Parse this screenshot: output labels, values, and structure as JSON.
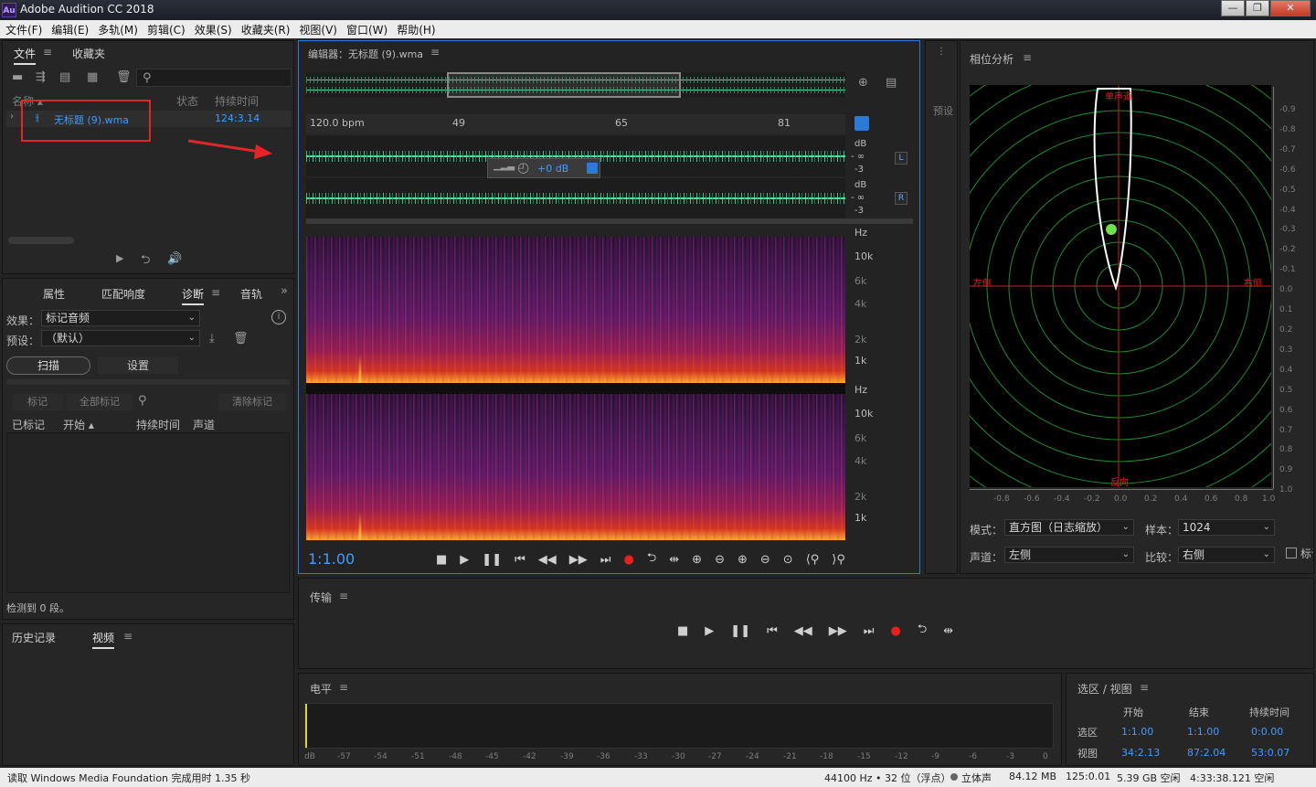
{
  "window": {
    "app_icon": "Au",
    "title": "Adobe Audition CC 2018",
    "min_label": "—",
    "max_label": "❐",
    "close_label": "✕"
  },
  "menu": [
    "文件(F)",
    "编辑(E)",
    "多轨(M)",
    "剪辑(C)",
    "效果(S)",
    "收藏夹(R)",
    "视图(V)",
    "窗口(W)",
    "帮助(H)"
  ],
  "files_panel": {
    "tabs": [
      "文件",
      "收藏夹"
    ],
    "columns": {
      "name": "名称 ▴",
      "status": "状态",
      "duration": "持续时间"
    },
    "file": {
      "name": "无标题 (9).wma",
      "duration": "124:3.14"
    }
  },
  "diag_panel": {
    "tabs": [
      "属性",
      "匹配响度",
      "诊断",
      "音轨"
    ],
    "effect_label": "效果：",
    "effect_value": "标记音频",
    "preset_label": "预设：",
    "preset_value": "（默认）",
    "scan_button": "扫描",
    "settings_button": "设置",
    "mark_button": "标记",
    "mark_all_button": "全部标记",
    "clear_button": "清除标记",
    "columns": [
      "已标记",
      "开始 ▴",
      "持续时间",
      "声道"
    ],
    "status": "检测到 0 段。"
  },
  "history_panel": {
    "tabs": [
      "历史记录",
      "视频"
    ]
  },
  "editor": {
    "title": "编辑器：无标题 (9).wma",
    "bpm": "120.0 bpm",
    "ruler": [
      "49",
      "65",
      "81"
    ],
    "db_label": "dB",
    "db_inf": "- ∞",
    "db_minus3": "-3",
    "ch_left": "L",
    "ch_right": "R",
    "volume": "+0 dB",
    "hz_labels": [
      "Hz",
      "10k",
      "6k",
      "4k",
      "2k",
      "1k"
    ],
    "time": "1:1.00"
  },
  "side_collapsed_label": "预设",
  "phase_panel": {
    "title": "相位分析",
    "label_mono": "单声道",
    "label_left": "左侧",
    "label_right": "右侧",
    "label_inverse": "反向",
    "right_ticks": [
      "-0.9",
      "-0.8",
      "-0.7",
      "-0.6",
      "-0.5",
      "-0.4",
      "-0.3",
      "-0.2",
      "-0.1",
      "0.0",
      "0.1",
      "0.2",
      "0.3",
      "0.4",
      "0.5",
      "0.6",
      "0.7",
      "0.8",
      "0.9",
      "1.0"
    ],
    "bottom_ticks": [
      "-0.8",
      "-0.6",
      "-0.4",
      "-0.2",
      "0.0",
      "0.2",
      "0.4",
      "0.6",
      "0.8",
      "1.0"
    ],
    "mode_label": "模式：",
    "mode_value": "直方图（日志缩放）",
    "sample_label": "样本：",
    "sample_value": "1024",
    "channel_label": "声道：",
    "channel_value": "左侧",
    "compare_label": "比较：",
    "compare_value": "右侧",
    "checkbox_label": "标记"
  },
  "transport_panel": {
    "title": "传输"
  },
  "level_panel": {
    "title": "电平",
    "scale": [
      "dB",
      "-57",
      "-54",
      "-51",
      "-48",
      "-45",
      "-42",
      "-39",
      "-36",
      "-33",
      "-30",
      "-27",
      "-24",
      "-21",
      "-18",
      "-15",
      "-12",
      "-9",
      "-6",
      "-3",
      "0"
    ]
  },
  "selection_panel": {
    "title": "选区 / 视图",
    "col_start": "开始",
    "col_end": "结束",
    "col_duration": "持续时间",
    "row_sel": "选区",
    "row_view": "视图",
    "sel_start": "1:1.00",
    "sel_end": "1:1.00",
    "sel_dur": "0:0.00",
    "view_start": "34:2.13",
    "view_end": "87:2.04",
    "view_dur": "53:0.07"
  },
  "status_bar": {
    "left": "读取 Windows Media Foundation 完成用时 1.35 秒",
    "rate": "44100 Hz • 32 位（浮点）",
    "channels": "立体声",
    "size": "84.12 MB",
    "length": "125:0.01",
    "free": "5.39 GB 空闲",
    "free_time": "4:33:38.121 空闲"
  },
  "colors": {
    "accent": "#3f9cff",
    "highlight_box": "#e0262a",
    "waveform": "#4fe0a0",
    "phase_grid": "#1f8a2e"
  }
}
